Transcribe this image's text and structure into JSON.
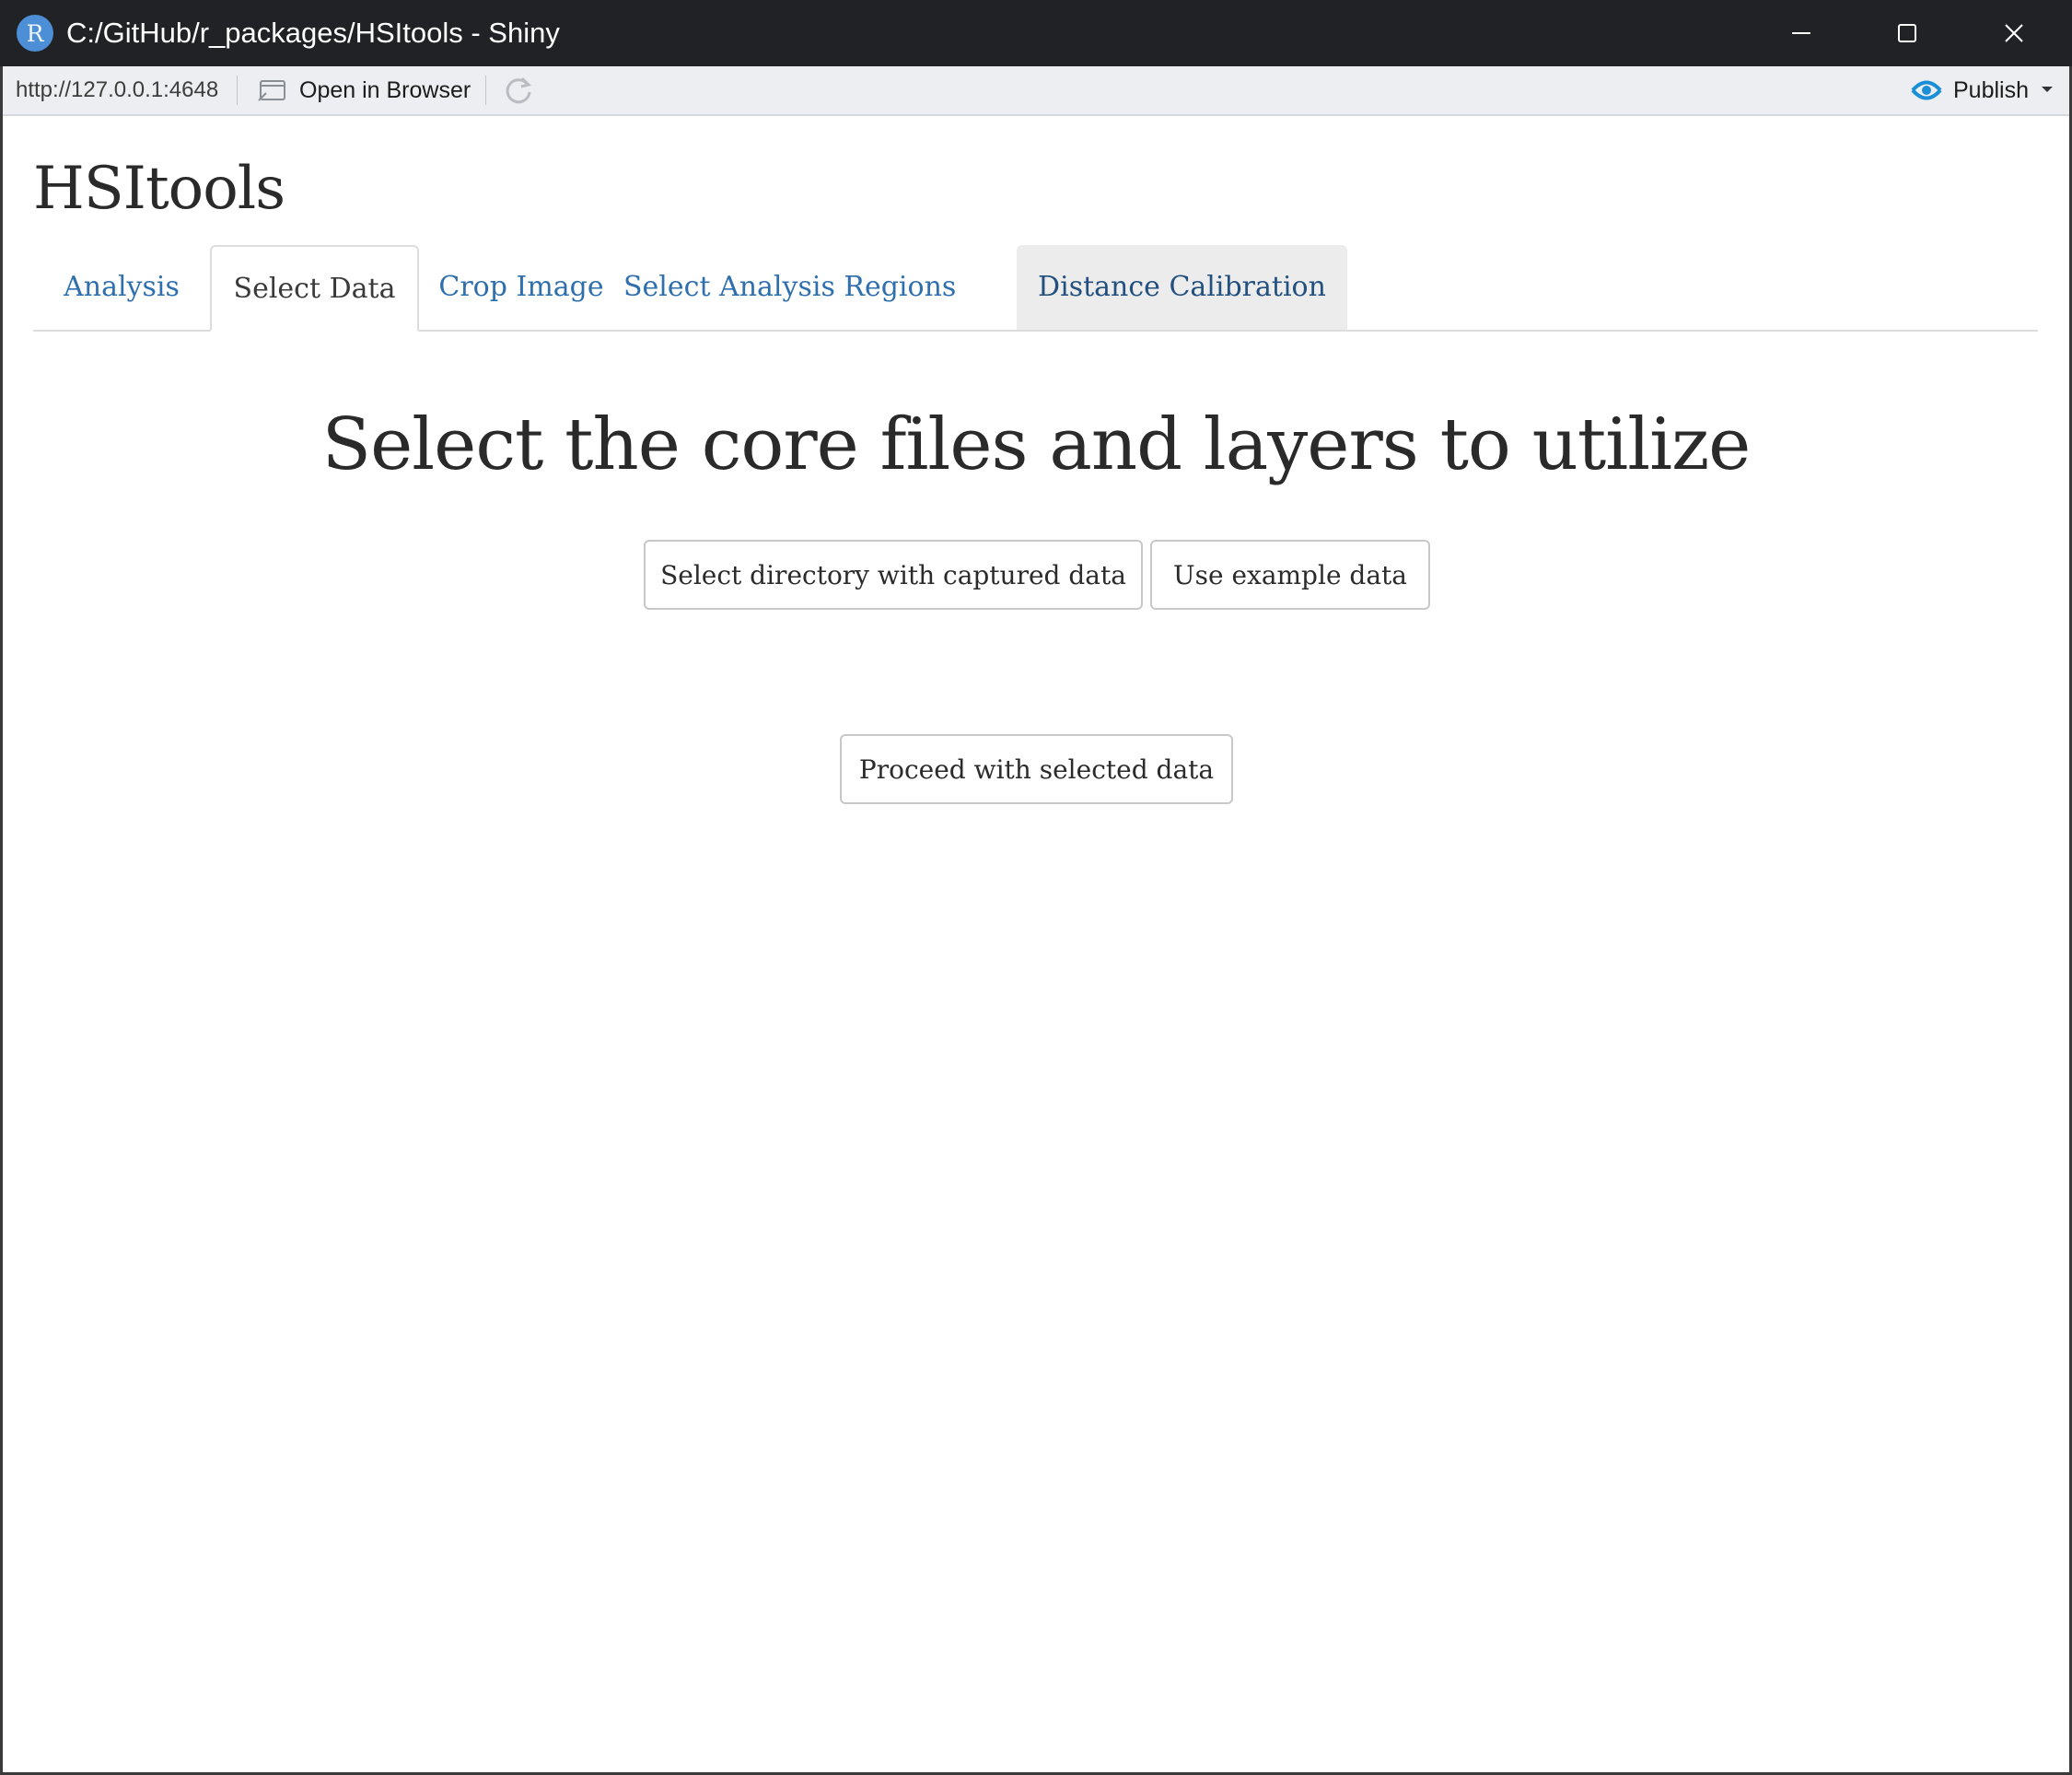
{
  "window": {
    "title": "C:/GitHub/r_packages/HSItools - Shiny",
    "logo_letter": "R"
  },
  "toolbar": {
    "url": "http://127.0.0.1:4648",
    "open_in_browser_label": "Open in Browser",
    "publish_label": "Publish"
  },
  "app": {
    "title": "HSItools"
  },
  "tabs": [
    {
      "label": "Analysis",
      "active": false
    },
    {
      "label": "Select Data",
      "active": true
    },
    {
      "label": "Crop Image",
      "active": false
    },
    {
      "label": "Select Analysis Regions",
      "active": false
    },
    {
      "label": "Distance Calibration",
      "active": false
    }
  ],
  "main": {
    "heading": "Select the core files and layers to utilize",
    "select_directory_label": "Select directory with captured data",
    "use_example_label": "Use example data",
    "proceed_label": "Proceed with selected data"
  },
  "colors": {
    "titlebar": "#202225",
    "tab_link": "#2f6fae",
    "publish_icon": "#1b8fd6"
  }
}
